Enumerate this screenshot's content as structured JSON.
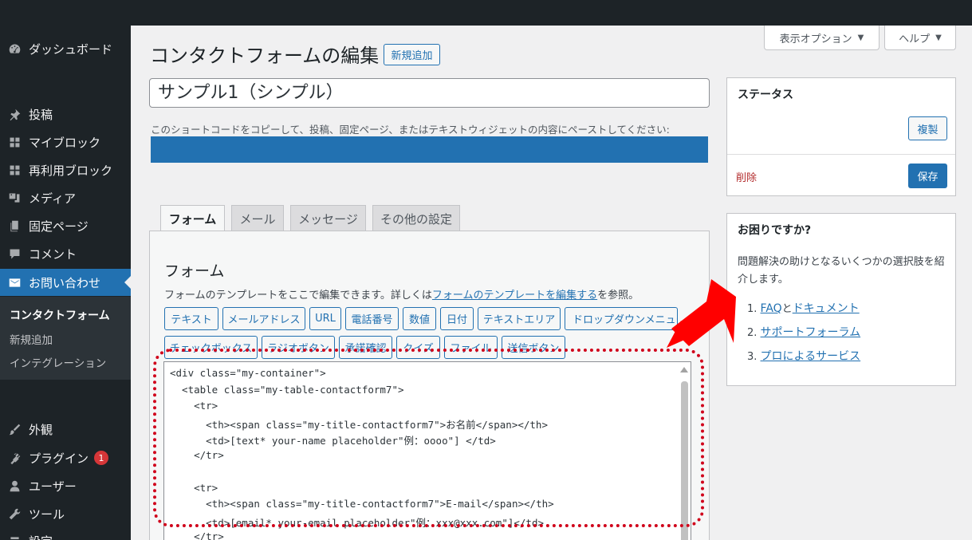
{
  "sidebar": {
    "items": [
      {
        "label": "ダッシュボード",
        "icon": "dashboard-icon"
      },
      {
        "label": "投稿",
        "icon": "pin-icon"
      },
      {
        "label": "マイブロック",
        "icon": "blocks-icon"
      },
      {
        "label": "再利用ブロック",
        "icon": "blocks-icon"
      },
      {
        "label": "メディア",
        "icon": "media-icon"
      },
      {
        "label": "固定ページ",
        "icon": "page-icon"
      },
      {
        "label": "コメント",
        "icon": "comment-icon"
      },
      {
        "label": "お問い合わせ",
        "icon": "mail-icon"
      },
      {
        "label": "外観",
        "icon": "brush-icon"
      },
      {
        "label": "プラグイン",
        "icon": "plugin-icon",
        "badge": "1"
      },
      {
        "label": "ユーザー",
        "icon": "user-icon"
      },
      {
        "label": "ツール",
        "icon": "wrench-icon"
      },
      {
        "label": "設定",
        "icon": "settings-icon"
      }
    ],
    "submenu": [
      "コンタクトフォーム",
      "新規追加",
      "インテグレーション"
    ]
  },
  "screen_meta": {
    "options": "表示オプション",
    "help": "ヘルプ"
  },
  "header": {
    "title": "コンタクトフォームの編集",
    "add_new": "新規追加"
  },
  "form_title": "サンプル1（シンプル）",
  "shortcode_desc": "このショートコードをコピーして、投稿、固定ページ、またはテキストウィジェットの内容にペーストしてください:",
  "tabs": [
    "フォーム",
    "メール",
    "メッセージ",
    "その他の設定"
  ],
  "panel": {
    "heading": "フォーム",
    "desc_before": "フォームのテンプレートをここで編集できます。詳しくは",
    "desc_link": "フォームのテンプレートを編集する",
    "desc_after": "を参照。"
  },
  "tag_buttons_row1": [
    "テキスト",
    "メールアドレス",
    "URL",
    "電話番号",
    "数値",
    "日付",
    "テキストエリア",
    "ドロップダウンメニュー"
  ],
  "tag_buttons_row2": [
    "チェックボックス",
    "ラジオボタン",
    "承諾確認",
    "クイズ",
    "ファイル",
    "送信ボタン"
  ],
  "code_lines": [
    "<div class=\"my-container\">",
    "  <table class=\"my-table-contactform7\">",
    "    <tr>",
    "      <th><span class=\"my-title-contactform7\">お名前</span></th>",
    "      <td>[text* your-name placeholder\"例：oooo\"] </td>",
    "    </tr>",
    "",
    "    <tr>",
    "      <th><span class=\"my-title-contactform7\">E-mail</span></th>",
    "      <td>[email* your-email placeholder\"例：xxx@xxx.com\"]</td>",
    "    </tr>"
  ],
  "status_box": {
    "title": "ステータス",
    "duplicate": "複製",
    "delete": "削除",
    "save": "保存"
  },
  "help_box": {
    "title": "お困りですか?",
    "text": "問題解決の助けとなるいくつかの選択肢を紹介します。",
    "items": [
      {
        "num": "1. ",
        "link1": "FAQ",
        "mid": "と",
        "link2": "ドキュメント"
      },
      {
        "num": "2. ",
        "link1": "サポートフォーラム"
      },
      {
        "num": "3. ",
        "link1": "プロによるサービス"
      }
    ]
  },
  "colors": {
    "accent": "#2271b1",
    "sidebar_bg": "#1d2327",
    "annotation_red": "#d0021b",
    "arrow_red": "#ff0000"
  }
}
